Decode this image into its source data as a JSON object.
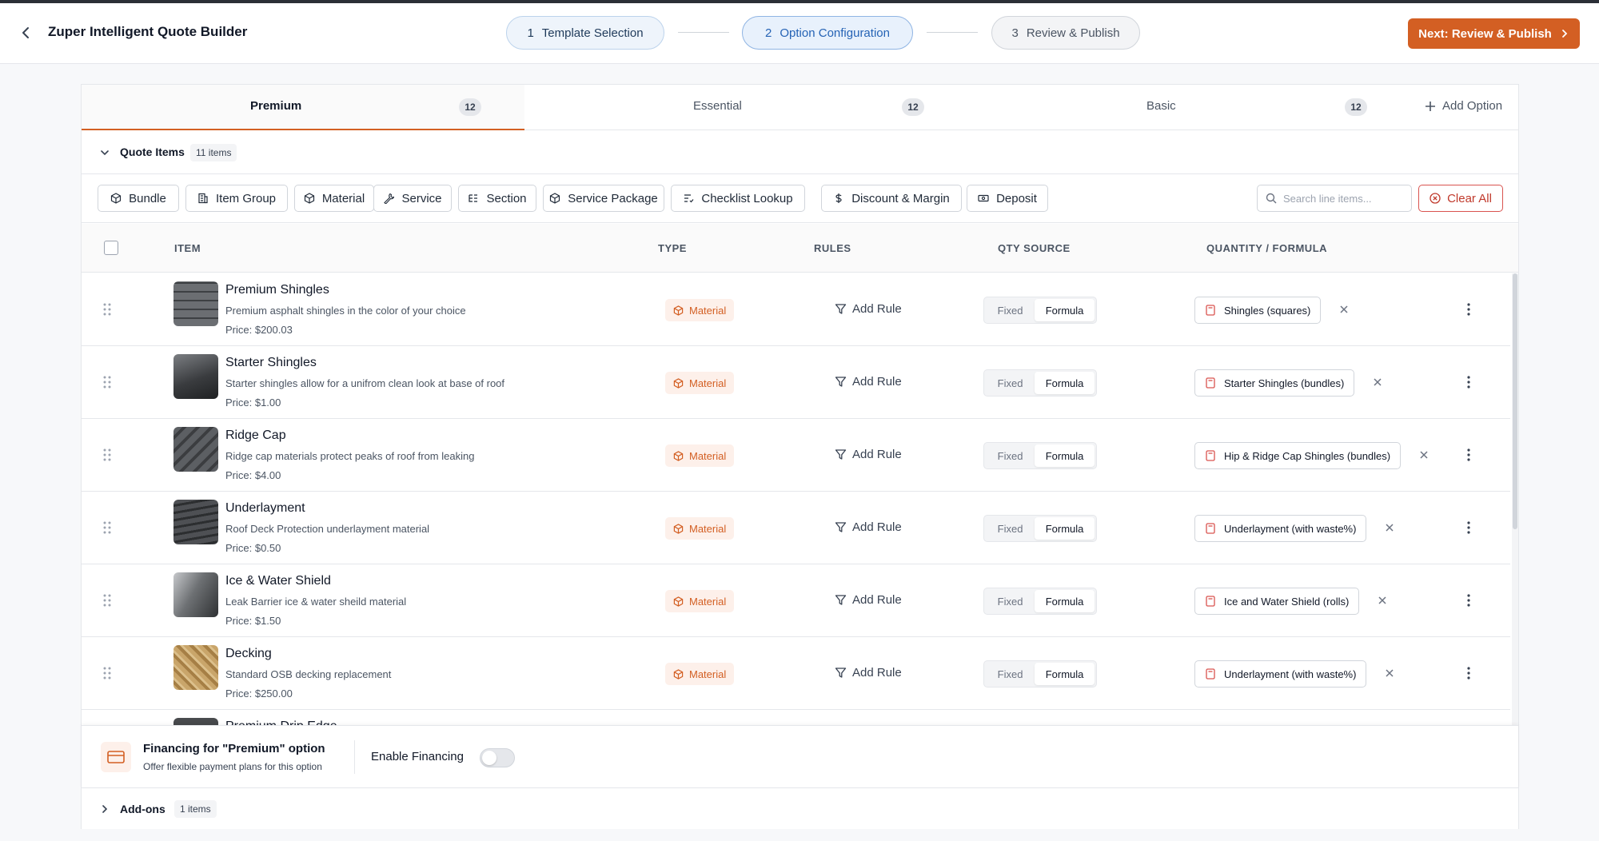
{
  "header": {
    "title": "Zuper Intelligent Quote Builder",
    "steps": [
      {
        "num": "1",
        "label": "Template Selection"
      },
      {
        "num": "2",
        "label": "Option Configuration"
      },
      {
        "num": "3",
        "label": "Review & Publish"
      }
    ],
    "next_label": "Next: Review & Publish"
  },
  "tabs": [
    {
      "label": "Premium",
      "count": "12"
    },
    {
      "label": "Essential",
      "count": "12"
    },
    {
      "label": "Basic",
      "count": "12"
    }
  ],
  "add_option_label": "Add Option",
  "quote_items": {
    "title": "Quote Items",
    "badge": "11 items"
  },
  "toolbar": {
    "buttons": [
      "Bundle",
      "Item Group",
      "Material",
      "Service",
      "Section",
      "Service Package",
      "Checklist Lookup",
      "Discount & Margin",
      "Deposit"
    ],
    "search_placeholder": "Search line items...",
    "clear_label": "Clear All"
  },
  "columns": {
    "item": "ITEM",
    "type": "TYPE",
    "rules": "RULES",
    "qty_source": "QTY SOURCE",
    "quantity": "QUANTITY / FORMULA"
  },
  "rows": [
    {
      "name": "Premium Shingles",
      "desc": "Premium asphalt shingles in the color of your choice",
      "price": "Price: $200.03",
      "type": "Material",
      "rule": "Add Rule",
      "fixed": "Fixed",
      "formula": "Formula",
      "chip": "Shingles (squares)"
    },
    {
      "name": "Starter Shingles",
      "desc": "Starter shingles allow for a unifrom clean look at base of roof",
      "price": "Price: $1.00",
      "type": "Material",
      "rule": "Add Rule",
      "fixed": "Fixed",
      "formula": "Formula",
      "chip": "Starter Shingles (bundles)"
    },
    {
      "name": "Ridge Cap",
      "desc": "Ridge cap materials protect peaks of roof from leaking",
      "price": "Price: $4.00",
      "type": "Material",
      "rule": "Add Rule",
      "fixed": "Fixed",
      "formula": "Formula",
      "chip": "Hip & Ridge Cap Shingles (bundles)"
    },
    {
      "name": "Underlayment",
      "desc": "Roof Deck Protection underlayment material",
      "price": "Price: $0.50",
      "type": "Material",
      "rule": "Add Rule",
      "fixed": "Fixed",
      "formula": "Formula",
      "chip": "Underlayment (with waste%)"
    },
    {
      "name": "Ice & Water Shield",
      "desc": "Leak Barrier ice & water sheild material",
      "price": "Price: $1.50",
      "type": "Material",
      "rule": "Add Rule",
      "fixed": "Fixed",
      "formula": "Formula",
      "chip": "Ice and Water Shield (rolls)"
    },
    {
      "name": "Decking",
      "desc": "Standard OSB decking replacement",
      "price": "Price: $250.00",
      "type": "Material",
      "rule": "Add Rule",
      "fixed": "Fixed",
      "formula": "Formula",
      "chip": "Underlayment (with waste%)"
    },
    {
      "name": "Premium Drip Edge",
      "desc": "",
      "price": "",
      "type": "",
      "rule": "",
      "fixed": "",
      "formula": "",
      "chip": ""
    }
  ],
  "financing": {
    "title": "Financing for \"Premium\" option",
    "subtitle": "Offer flexible payment plans for this option",
    "enable_label": "Enable Financing",
    "enabled": false
  },
  "addons": {
    "title": "Add-ons",
    "badge": "1 items"
  },
  "colors": {
    "accent": "#d35f23",
    "active_step": "#2563b5",
    "danger": "#c0392b"
  }
}
